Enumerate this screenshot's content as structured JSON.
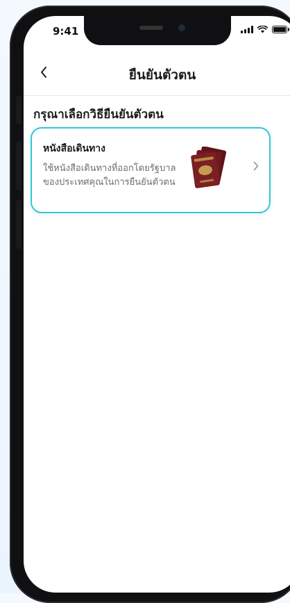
{
  "status_bar": {
    "time": "9:41"
  },
  "navbar": {
    "title": "ยืนยันตัวตน"
  },
  "section": {
    "title": "กรุณาเลือกวิธียืนยันตัวตน"
  },
  "options": [
    {
      "title": "หนังสือเดินทาง",
      "description": "ใช้หนังสือเดินทางที่ออกโดยรัฐบาลของประเทศคุณในการยืนยันตัวตน",
      "image": "passport-image"
    }
  ],
  "colors": {
    "card_border": "#2ec8d8",
    "passport": "#7a1f24"
  }
}
